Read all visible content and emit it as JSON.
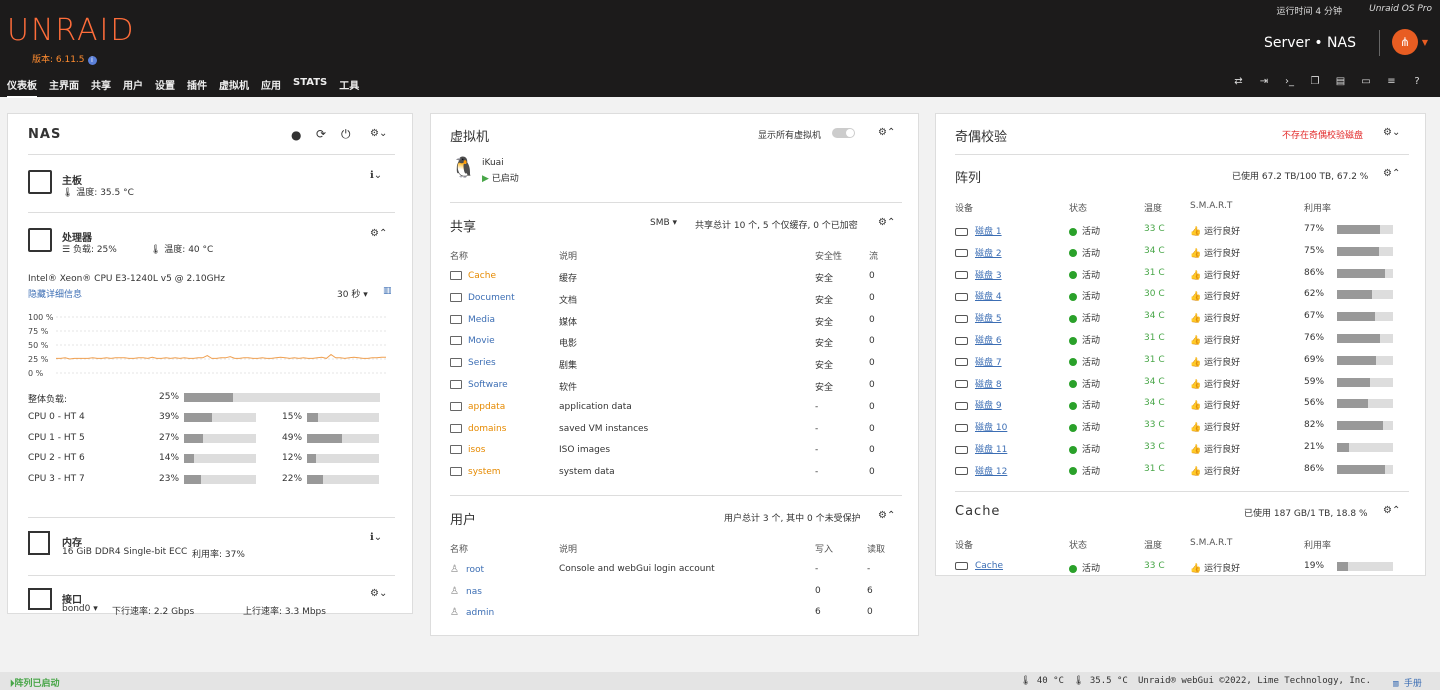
{
  "header": {
    "logo": "UNRAID",
    "version": "版本: 6.11.5",
    "version_info_icon": "info-icon",
    "uptime": "运行时间 4 分钟",
    "os_edition": "Unraid OS Pro",
    "server": "Server • NAS",
    "nav": [
      "仪表板",
      "主界面",
      "共享",
      "用户",
      "设置",
      "插件",
      "虚拟机",
      "应用",
      "STATS",
      "工具"
    ],
    "toolbar_icons": [
      "switch-icon",
      "logout-icon",
      "terminal-icon",
      "copy-icon",
      "feedback-icon",
      "monitor-icon",
      "log-icon",
      "help-icon"
    ]
  },
  "nas": {
    "title": "NAS",
    "board": {
      "title": "主板",
      "temp": "温度: 35.5 °C"
    },
    "cpu": {
      "title": "处理器",
      "load": "负载: 25%",
      "temp": "温度: 40 °C",
      "model": "Intel® Xeon® CPU E3-1240L v5 @ 2.10GHz",
      "hide": "隐藏详细信息",
      "interval": "30 秒",
      "y_ticks": [
        "100 %",
        "75 %",
        "50 %",
        "25 %",
        "0 %"
      ],
      "overall_label": "整体负载:",
      "overall": "25%",
      "overall_value": 25,
      "rows": [
        {
          "label": "CPU 0 - HT 4",
          "a": "39%",
          "av": 39,
          "b": "15%",
          "bv": 15
        },
        {
          "label": "CPU 1 - HT 5",
          "a": "27%",
          "av": 27,
          "b": "49%",
          "bv": 49
        },
        {
          "label": "CPU 2 - HT 6",
          "a": "14%",
          "av": 14,
          "b": "12%",
          "bv": 12
        },
        {
          "label": "CPU 3 - HT 7",
          "a": "23%",
          "av": 23,
          "b": "22%",
          "bv": 22
        }
      ]
    },
    "memory": {
      "title": "内存",
      "spec": "16 GiB DDR4 Single-bit ECC",
      "usage": "利用率: 37%"
    },
    "net": {
      "title": "接口",
      "iface": "bond0",
      "down": "下行速率: 2.2 Gbps",
      "up": "上行速率: 3.3 Mbps"
    }
  },
  "vm": {
    "title": "虚拟机",
    "show_all": "显示所有虚拟机",
    "name": "iKuai",
    "state": "已启动"
  },
  "shares": {
    "title": "共享",
    "proto": "SMB",
    "summary": "共享总计 10 个, 5 个仅缓存, 0 个已加密",
    "headers": [
      "名称",
      "说明",
      "安全性",
      "流"
    ],
    "rows": [
      {
        "name": "Cache",
        "desc": "缓存",
        "sec": "安全",
        "streams": "0",
        "color": "orange"
      },
      {
        "name": "Document",
        "desc": "文档",
        "sec": "安全",
        "streams": "0",
        "color": "link"
      },
      {
        "name": "Media",
        "desc": "媒体",
        "sec": "安全",
        "streams": "0",
        "color": "link"
      },
      {
        "name": "Movie",
        "desc": "电影",
        "sec": "安全",
        "streams": "0",
        "color": "link"
      },
      {
        "name": "Series",
        "desc": "剧集",
        "sec": "安全",
        "streams": "0",
        "color": "link"
      },
      {
        "name": "Software",
        "desc": "软件",
        "sec": "安全",
        "streams": "0",
        "color": "link"
      },
      {
        "name": "appdata",
        "desc": "application data",
        "sec": "-",
        "streams": "0",
        "color": "orange"
      },
      {
        "name": "domains",
        "desc": "saved VM instances",
        "sec": "-",
        "streams": "0",
        "color": "orange"
      },
      {
        "name": "isos",
        "desc": "ISO images",
        "sec": "-",
        "streams": "0",
        "color": "orange"
      },
      {
        "name": "system",
        "desc": "system data",
        "sec": "-",
        "streams": "0",
        "color": "orange"
      }
    ]
  },
  "users": {
    "title": "用户",
    "summary": "用户总计 3 个, 其中 0 个未受保护",
    "headers": [
      "名称",
      "说明",
      "写入",
      "读取"
    ],
    "rows": [
      {
        "name": "root",
        "desc": "Console and webGui login account",
        "w": "-",
        "r": "-"
      },
      {
        "name": "nas",
        "desc": "",
        "w": "0",
        "r": "6"
      },
      {
        "name": "admin",
        "desc": "",
        "w": "6",
        "r": "0"
      }
    ]
  },
  "parity": {
    "title": "奇偶校验",
    "status": "不存在奇偶校验磁盘"
  },
  "array": {
    "title": "阵列",
    "usage": "已使用 67.2 TB/100 TB, 67.2 %",
    "headers": [
      "设备",
      "状态",
      "温度",
      "S.M.A.R.T",
      "利用率"
    ],
    "disks": [
      {
        "name": "磁盘 1",
        "state": "活动",
        "temp": "33 C",
        "smart": "运行良好",
        "util": "77%",
        "v": 77
      },
      {
        "name": "磁盘 2",
        "state": "活动",
        "temp": "34 C",
        "smart": "运行良好",
        "util": "75%",
        "v": 75
      },
      {
        "name": "磁盘 3",
        "state": "活动",
        "temp": "31 C",
        "smart": "运行良好",
        "util": "86%",
        "v": 86
      },
      {
        "name": "磁盘 4",
        "state": "活动",
        "temp": "30 C",
        "smart": "运行良好",
        "util": "62%",
        "v": 62
      },
      {
        "name": "磁盘 5",
        "state": "活动",
        "temp": "34 C",
        "smart": "运行良好",
        "util": "67%",
        "v": 67
      },
      {
        "name": "磁盘 6",
        "state": "活动",
        "temp": "31 C",
        "smart": "运行良好",
        "util": "76%",
        "v": 76
      },
      {
        "name": "磁盘 7",
        "state": "活动",
        "temp": "31 C",
        "smart": "运行良好",
        "util": "69%",
        "v": 69
      },
      {
        "name": "磁盘 8",
        "state": "活动",
        "temp": "34 C",
        "smart": "运行良好",
        "util": "59%",
        "v": 59
      },
      {
        "name": "磁盘 9",
        "state": "活动",
        "temp": "34 C",
        "smart": "运行良好",
        "util": "56%",
        "v": 56
      },
      {
        "name": "磁盘 10",
        "state": "活动",
        "temp": "33 C",
        "smart": "运行良好",
        "util": "82%",
        "v": 82
      },
      {
        "name": "磁盘 11",
        "state": "活动",
        "temp": "33 C",
        "smart": "运行良好",
        "util": "21%",
        "v": 21
      },
      {
        "name": "磁盘 12",
        "state": "活动",
        "temp": "31 C",
        "smart": "运行良好",
        "util": "86%",
        "v": 86
      }
    ]
  },
  "cache": {
    "title": "Cache",
    "usage": "已使用 187 GB/1 TB, 18.8 %",
    "headers": [
      "设备",
      "状态",
      "温度",
      "S.M.A.R.T",
      "利用率"
    ],
    "disk": {
      "name": "Cache",
      "state": "活动",
      "temp": "33 C",
      "smart": "运行良好",
      "util": "19%",
      "v": 19
    }
  },
  "footer": {
    "status": "阵列已启动",
    "cpu_temp": "40 °C",
    "board_temp": "35.5 °C",
    "copyright": "Unraid® webGui ©2022, Lime Technology, Inc.",
    "manual": "手册"
  },
  "colors": {
    "header_bg": "#1c1b1b",
    "accent": "#ff6d3a",
    "link": "#3c6eb4",
    "orange": "#e68a00",
    "green": "#48a648",
    "red": "#e22828"
  }
}
